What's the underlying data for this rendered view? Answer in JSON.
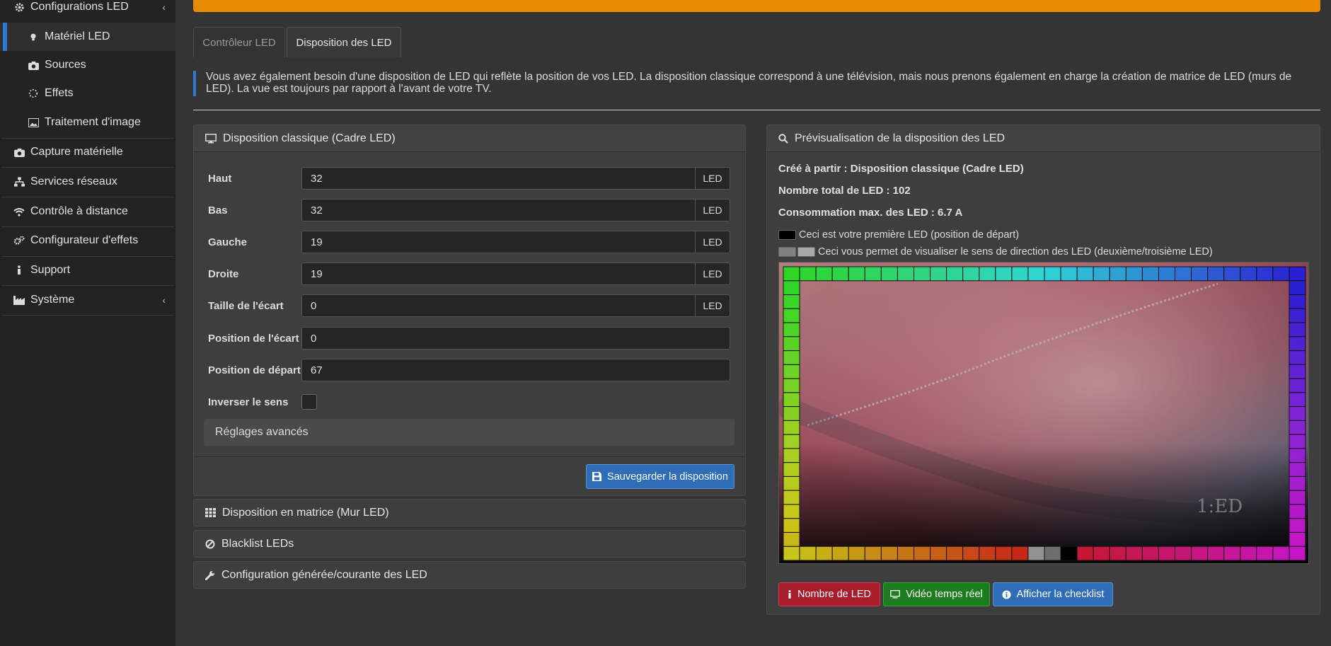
{
  "sidebar": {
    "items": [
      {
        "label": "Configurations LED",
        "icon": "gear-icon"
      },
      {
        "label": "Matériel LED",
        "icon": "lightbulb-icon"
      },
      {
        "label": "Sources",
        "icon": "camera-icon"
      },
      {
        "label": "Effets",
        "icon": "spinner-icon"
      },
      {
        "label": "Traitement d'image",
        "icon": "image-icon"
      },
      {
        "label": "Capture matérielle",
        "icon": "camera-icon"
      },
      {
        "label": "Services réseaux",
        "icon": "network-icon"
      },
      {
        "label": "Contrôle à distance",
        "icon": "wifi-icon"
      },
      {
        "label": "Configurateur d'effets",
        "icon": "cogs-icon"
      },
      {
        "label": "Support",
        "icon": "info-icon"
      },
      {
        "label": "Système",
        "icon": "industry-icon"
      }
    ]
  },
  "tabs": [
    "Contrôleur LED",
    "Disposition des LED"
  ],
  "info_text": "Vous avez également besoin d'une disposition de LED qui reflète la position de vos LED. La disposition classique correspond à une télévision, mais nous prenons également en charge la création de matrice de LED (murs de LED). La vue est toujours par rapport à l'avant de votre TV.",
  "classic": {
    "title": "Disposition classique (Cadre LED)",
    "fields": [
      {
        "label": "Haut",
        "value": "32",
        "addon": "LED"
      },
      {
        "label": "Bas",
        "value": "32",
        "addon": "LED"
      },
      {
        "label": "Gauche",
        "value": "19",
        "addon": "LED"
      },
      {
        "label": "Droite",
        "value": "19",
        "addon": "LED"
      },
      {
        "label": "Taille de l'écart",
        "value": "0",
        "addon": "LED"
      },
      {
        "label": "Position de l'écart",
        "value": "0"
      },
      {
        "label": "Position de départ",
        "value": "67"
      }
    ],
    "reverse_label": "Inverser le sens",
    "advanced_label": "Réglages avancés",
    "save_label": "Sauvegarder la disposition"
  },
  "sections": [
    {
      "label": "Disposition en matrice (Mur LED)",
      "icon": "grid-icon"
    },
    {
      "label": "Blacklist LEDs",
      "icon": "ban-icon"
    },
    {
      "label": "Configuration générée/courante des LED",
      "icon": "wrench-icon"
    }
  ],
  "preview": {
    "title": "Prévisualisation de la disposition des LED",
    "created_from": "Créé à partir : Disposition classique (Cadre LED)",
    "total": "Nombre total de LED : 102",
    "consumption": "Consommation max. des LED : 6.7 A",
    "legend_first": "Ceci est votre première LED (position de départ)",
    "legend_direction": "Ceci vous permet de visualiser le sens de direction des LED (deuxième/troisième LED)",
    "image_text": "1:ED"
  },
  "buttons": {
    "led_count": "Nombre de LED",
    "realtime": "Vidéo temps réel",
    "checklist": "Afficher la checklist"
  },
  "colors": {
    "accent": "#2f7ad1",
    "banner": "#e88a00",
    "led_count_btn": "#a81c2c",
    "realtime_btn": "#1d7c1d",
    "checklist_btn": "#2f6db8"
  }
}
